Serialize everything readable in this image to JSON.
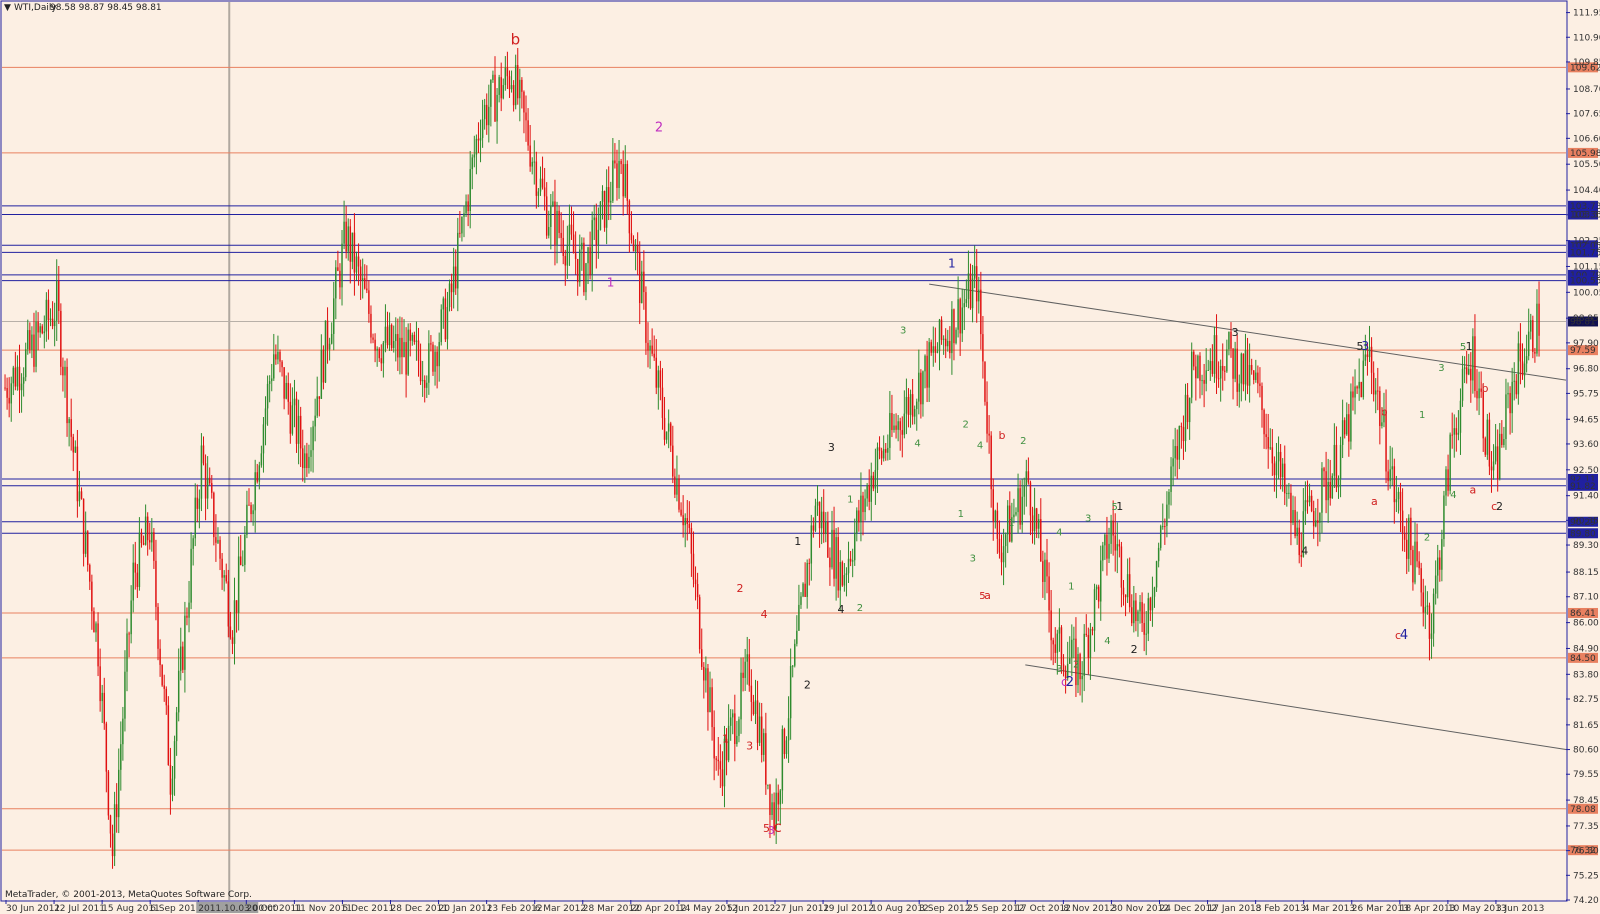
{
  "header": {
    "symbol_label": "WTI,Daily",
    "ohlc_text": "98.58 98.87 98.45 98.81",
    "copyright": "MetaTrader, © 2001-2013, MetaQuotes Software Corp."
  },
  "colors": {
    "background": "#fcefe3",
    "bull_candle": "#2e8b2e",
    "bear_candle": "#e01010",
    "resistance_line": "#e88060",
    "support_line": "#2020a0",
    "trend_line": "#606060",
    "axis": "#2020a0"
  },
  "chart_data": {
    "type": "candlestick",
    "title": "",
    "xlabel": "",
    "ylabel": "",
    "ylim": [
      74.2,
      112.4
    ],
    "y_ticks": [
      "111.95",
      "110.90",
      "109.85",
      "108.70",
      "107.65",
      "106.60",
      "105.50",
      "104.40",
      "103.35",
      "102.25",
      "101.15",
      "100.05",
      "98.95",
      "97.90",
      "96.80",
      "95.75",
      "94.65",
      "93.60",
      "92.50",
      "91.40",
      "90.35",
      "89.30",
      "88.15",
      "87.10",
      "86.00",
      "84.90",
      "83.80",
      "82.75",
      "81.65",
      "80.60",
      "79.55",
      "78.45",
      "77.35",
      "76.30",
      "75.25",
      "74.20"
    ],
    "x_dates": [
      "30 Jun 2011",
      "22 Jul 2011",
      "15 Aug 2011",
      "6 Sep 2011",
      "2011.10.03 00:00",
      "20 Oct 2011",
      "11 Nov 2011",
      "5 Dec 2011",
      "28 Dec 2011",
      "20 Jan 2012",
      "13 Feb 2012",
      "6 Mar 2012",
      "28 Mar 2012",
      "20 Apr 2012",
      "14 May 2012",
      "5 Jun 2012",
      "27 Jun 2012",
      "19 Jul 2012",
      "10 Aug 2012",
      "3 Sep 2012",
      "25 Sep 2012",
      "17 Oct 2012",
      "8 Nov 2012",
      "30 Nov 2012",
      "24 Dec 2012",
      "17 Jan 2013",
      "8 Feb 2013",
      "4 Mar 2013",
      "26 Mar 2013",
      "18 Apr 2013",
      "10 May 2013",
      "3 Jun 2013"
    ],
    "current_price": "98.81",
    "price_path_keypoints": [
      [
        0,
        96.0
      ],
      [
        12,
        97.5
      ],
      [
        25,
        99.5
      ],
      [
        32,
        94.0
      ],
      [
        45,
        85.0
      ],
      [
        52,
        76.2
      ],
      [
        62,
        88.0
      ],
      [
        70,
        90.0
      ],
      [
        80,
        79.5
      ],
      [
        95,
        93.0
      ],
      [
        110,
        86.0
      ],
      [
        130,
        97.5
      ],
      [
        145,
        93.0
      ],
      [
        165,
        102.5
      ],
      [
        180,
        98.0
      ],
      [
        205,
        97.0
      ],
      [
        215,
        99.5
      ],
      [
        230,
        107.5
      ],
      [
        245,
        109.4
      ],
      [
        262,
        103.5
      ],
      [
        280,
        101.0
      ],
      [
        298,
        105.8
      ],
      [
        312,
        97.5
      ],
      [
        330,
        90.0
      ],
      [
        345,
        79.5
      ],
      [
        360,
        84.0
      ],
      [
        372,
        77.8
      ],
      [
        392,
        91.0
      ],
      [
        405,
        88.0
      ],
      [
        420,
        92.5
      ],
      [
        450,
        97.5
      ],
      [
        470,
        100.5
      ],
      [
        480,
        89.0
      ],
      [
        495,
        92.0
      ],
      [
        508,
        85.0
      ],
      [
        520,
        84.0
      ],
      [
        535,
        90.0
      ],
      [
        550,
        85.5
      ],
      [
        575,
        97.0
      ],
      [
        590,
        97.5
      ],
      [
        605,
        96.0
      ],
      [
        625,
        89.5
      ],
      [
        645,
        93.0
      ],
      [
        660,
        97.5
      ],
      [
        672,
        91.5
      ],
      [
        690,
        86.0
      ],
      [
        700,
        94.0
      ],
      [
        710,
        97.5
      ],
      [
        720,
        92.0
      ],
      [
        730,
        96.5
      ],
      [
        742,
        98.9
      ]
    ],
    "horizontal_levels": [
      {
        "value": "109.62",
        "kind": "resistance"
      },
      {
        "value": "105.98",
        "kind": "resistance"
      },
      {
        "value": "103.73",
        "kind": "support"
      },
      {
        "value": "103.36",
        "kind": "support"
      },
      {
        "value": "102.05",
        "kind": "support"
      },
      {
        "value": "101.75",
        "kind": "support"
      },
      {
        "value": "100.79",
        "kind": "support"
      },
      {
        "value": "100.55",
        "kind": "support"
      },
      {
        "value": "98.81",
        "kind": "current"
      },
      {
        "value": "97.59",
        "kind": "resistance"
      },
      {
        "value": "92.11",
        "kind": "support"
      },
      {
        "value": "91.82",
        "kind": "support"
      },
      {
        "value": "90.29",
        "kind": "support"
      },
      {
        "value": "89.80",
        "kind": "support"
      },
      {
        "value": "86.41",
        "kind": "resistance"
      },
      {
        "value": "84.50",
        "kind": "resistance"
      },
      {
        "value": "78.08",
        "kind": "resistance"
      },
      {
        "value": "76.32",
        "kind": "resistance"
      }
    ],
    "trend_lines": [
      {
        "from": [
          "3 Sep 2012",
          100.4
        ],
        "to": [
          "3 Jun 2013",
          96.7
        ]
      },
      {
        "from": [
          "17 Oct 2012",
          84.2
        ],
        "to": [
          "3 Jun 2013",
          81.0
        ]
      }
    ],
    "wave_labels": [
      {
        "text": "b",
        "color": "#d02020",
        "date_idx": 10.5,
        "price": 110.6,
        "size": 15
      },
      {
        "text": "2",
        "color": "#c030c0",
        "date_idx": 13.5,
        "price": 106.9,
        "size": 13
      },
      {
        "text": "1",
        "color": "#c030c0",
        "date_idx": 12.5,
        "price": 100.3,
        "size": 12
      },
      {
        "text": "1",
        "color": "#2020a0",
        "date_idx": 19.6,
        "price": 101.1,
        "size": 12
      },
      {
        "text": "3",
        "color": "#409040",
        "date_idx": 18.6,
        "price": 98.3,
        "size": 10
      },
      {
        "text": "3",
        "color": "#202020",
        "date_idx": 17.1,
        "price": 93.3,
        "size": 11
      },
      {
        "text": "1",
        "color": "#202020",
        "date_idx": 16.4,
        "price": 89.3,
        "size": 11
      },
      {
        "text": "2",
        "color": "#d02020",
        "date_idx": 15.2,
        "price": 87.3,
        "size": 11
      },
      {
        "text": "4",
        "color": "#d02020",
        "date_idx": 15.7,
        "price": 86.2,
        "size": 11
      },
      {
        "text": "1",
        "color": "#d02020",
        "date_idx": 14.9,
        "price": 80.9,
        "size": 11
      },
      {
        "text": "3",
        "color": "#d02020",
        "date_idx": 15.4,
        "price": 80.6,
        "size": 11
      },
      {
        "text": "5",
        "color": "#d02020",
        "date_idx": 15.75,
        "price": 77.1,
        "size": 11
      },
      {
        "text": "3",
        "color": "#c030c0",
        "date_idx": 15.85,
        "price": 77.0,
        "size": 11
      },
      {
        "text": "c",
        "color": "#d02020",
        "date_idx": 15.97,
        "price": 77.1,
        "size": 15
      },
      {
        "text": "1",
        "color": "#409040",
        "date_idx": 17.5,
        "price": 91.1,
        "size": 10
      },
      {
        "text": "4",
        "color": "#202020",
        "date_idx": 17.3,
        "price": 86.4,
        "size": 11
      },
      {
        "text": "2",
        "color": "#409040",
        "date_idx": 17.7,
        "price": 86.5,
        "size": 10
      },
      {
        "text": "2",
        "color": "#202020",
        "date_idx": 16.6,
        "price": 83.2,
        "size": 11
      },
      {
        "text": "4",
        "color": "#409040",
        "date_idx": 18.9,
        "price": 93.5,
        "size": 10
      },
      {
        "text": "2",
        "color": "#409040",
        "date_idx": 19.9,
        "price": 94.3,
        "size": 10
      },
      {
        "text": "1",
        "color": "#409040",
        "date_idx": 19.8,
        "price": 90.5,
        "size": 10
      },
      {
        "text": "3",
        "color": "#409040",
        "date_idx": 20.05,
        "price": 88.6,
        "size": 10
      },
      {
        "text": "4",
        "color": "#409040",
        "date_idx": 20.2,
        "price": 93.4,
        "size": 10
      },
      {
        "text": "b",
        "color": "#d02020",
        "date_idx": 20.65,
        "price": 93.8,
        "size": 11
      },
      {
        "text": "2",
        "color": "#409040",
        "date_idx": 21.1,
        "price": 93.6,
        "size": 10
      },
      {
        "text": "1",
        "color": "#409040",
        "date_idx": 20.85,
        "price": 90.1,
        "size": 10
      },
      {
        "text": "5",
        "color": "#d02020",
        "date_idx": 20.25,
        "price": 87.0,
        "size": 10
      },
      {
        "text": "a",
        "color": "#d02020",
        "date_idx": 20.35,
        "price": 87.0,
        "size": 11
      },
      {
        "text": "4",
        "color": "#409040",
        "date_idx": 21.85,
        "price": 89.7,
        "size": 10
      },
      {
        "text": "3",
        "color": "#409040",
        "date_idx": 22.45,
        "price": 90.3,
        "size": 10
      },
      {
        "text": "5",
        "color": "#409040",
        "date_idx": 23.0,
        "price": 90.8,
        "size": 10
      },
      {
        "text": "1",
        "color": "#202020",
        "date_idx": 23.1,
        "price": 90.8,
        "size": 11
      },
      {
        "text": "1",
        "color": "#409040",
        "date_idx": 22.1,
        "price": 87.4,
        "size": 10
      },
      {
        "text": "3",
        "color": "#409040",
        "date_idx": 21.85,
        "price": 83.9,
        "size": 10
      },
      {
        "text": "2",
        "color": "#409040",
        "date_idx": 22.2,
        "price": 84.1,
        "size": 10
      },
      {
        "text": "4",
        "color": "#409040",
        "date_idx": 22.85,
        "price": 85.1,
        "size": 10
      },
      {
        "text": "2",
        "color": "#202020",
        "date_idx": 23.4,
        "price": 84.7,
        "size": 11
      },
      {
        "text": "c",
        "color": "#c030c0",
        "date_idx": 21.95,
        "price": 83.3,
        "size": 12
      },
      {
        "text": "2",
        "color": "#2020a0",
        "date_idx": 22.05,
        "price": 83.3,
        "size": 13
      },
      {
        "text": "3",
        "color": "#202020",
        "date_idx": 25.5,
        "price": 98.2,
        "size": 11
      },
      {
        "text": "4",
        "color": "#202020",
        "date_idx": 26.95,
        "price": 88.9,
        "size": 11
      },
      {
        "text": "5",
        "color": "#202020",
        "date_idx": 28.1,
        "price": 97.6,
        "size": 11
      },
      {
        "text": "3",
        "color": "#2020a0",
        "date_idx": 28.2,
        "price": 97.6,
        "size": 12
      },
      {
        "text": "b",
        "color": "#d02020",
        "date_idx": 28.6,
        "price": 94.8,
        "size": 11
      },
      {
        "text": "a",
        "color": "#d02020",
        "date_idx": 28.4,
        "price": 91.0,
        "size": 11
      },
      {
        "text": "c",
        "color": "#d02020",
        "date_idx": 28.9,
        "price": 85.3,
        "size": 11
      },
      {
        "text": "4",
        "color": "#2020a0",
        "date_idx": 29.0,
        "price": 85.3,
        "size": 13
      },
      {
        "text": "1",
        "color": "#409040",
        "date_idx": 29.4,
        "price": 94.7,
        "size": 10
      },
      {
        "text": "2",
        "color": "#409040",
        "date_idx": 29.5,
        "price": 89.5,
        "size": 10
      },
      {
        "text": "3",
        "color": "#409040",
        "date_idx": 29.8,
        "price": 96.7,
        "size": 10
      },
      {
        "text": "5",
        "color": "#409040",
        "date_idx": 30.25,
        "price": 97.6,
        "size": 10
      },
      {
        "text": "1",
        "color": "#202020",
        "date_idx": 30.37,
        "price": 97.6,
        "size": 11
      },
      {
        "text": "b",
        "color": "#d02020",
        "date_idx": 30.7,
        "price": 95.8,
        "size": 11
      },
      {
        "text": "4",
        "color": "#409040",
        "date_idx": 30.05,
        "price": 91.3,
        "size": 10
      },
      {
        "text": "a",
        "color": "#d02020",
        "date_idx": 30.45,
        "price": 91.5,
        "size": 11
      },
      {
        "text": "c",
        "color": "#d02020",
        "date_idx": 30.9,
        "price": 90.8,
        "size": 11
      },
      {
        "text": "2",
        "color": "#202020",
        "date_idx": 31.0,
        "price": 90.8,
        "size": 11
      }
    ]
  }
}
